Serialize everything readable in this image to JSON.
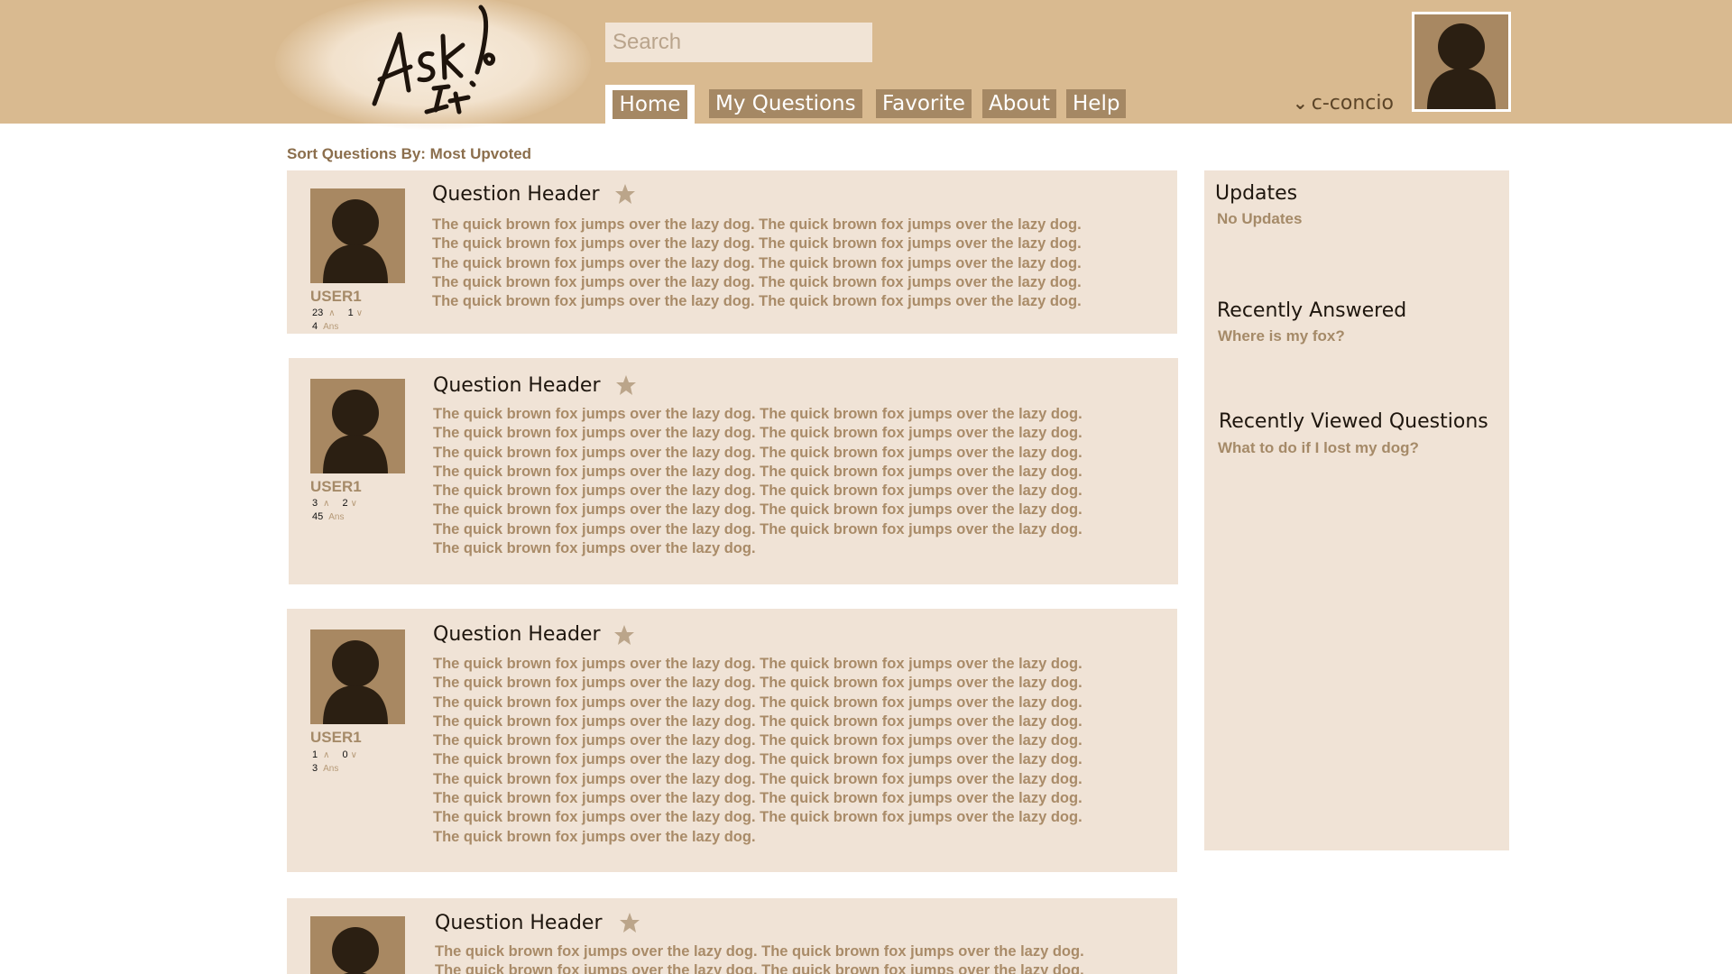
{
  "header": {
    "logo_text": "Ask It!",
    "search_placeholder": "Search",
    "nav": [
      "Home",
      "My Questions",
      "Favorite",
      "About",
      "Help"
    ],
    "username": "c-concio",
    "colors": {
      "header_bg": "#d9ba90",
      "nav_bg": "#a58864",
      "panel_bg": "#f0e3d6"
    }
  },
  "sort": {
    "label": "Sort Questions By: Most Upvoted"
  },
  "questions": [
    {
      "title": "Question Header",
      "user": "USER1",
      "upvotes": "23",
      "downvotes": "1",
      "answers": "4",
      "lines": [
        "The quick brown fox jumps over the lazy dog. The quick brown fox jumps over the lazy dog.",
        "The quick brown fox jumps over the lazy dog. The quick brown fox jumps over the lazy dog.",
        "The quick brown fox jumps over the lazy dog. The quick brown fox jumps over the lazy dog.",
        "The quick brown fox jumps over the lazy dog. The quick brown fox jumps over the lazy dog.",
        "The quick brown fox jumps over the lazy dog. The quick brown fox jumps over the lazy dog."
      ]
    },
    {
      "title": "Question Header",
      "user": "USER1",
      "upvotes": "3",
      "downvotes": "2",
      "answers": "45",
      "lines": [
        "The quick brown fox jumps over the lazy dog. The quick brown fox jumps over the lazy dog.",
        "The quick brown fox jumps over the lazy dog. The quick brown fox jumps over the lazy dog.",
        "The quick brown fox jumps over the lazy dog. The quick brown fox jumps over the lazy dog.",
        "The quick brown fox jumps over the lazy dog. The quick brown fox jumps over the lazy dog.",
        "The quick brown fox jumps over the lazy dog. The quick brown fox jumps over the lazy dog.",
        "The quick brown fox jumps over the lazy dog. The quick brown fox jumps over the lazy dog.",
        "The quick brown fox jumps over the lazy dog. The quick brown fox jumps over the lazy dog.",
        "The quick brown fox jumps over the lazy dog."
      ]
    },
    {
      "title": "Question Header",
      "user": "USER1",
      "upvotes": "1",
      "downvotes": "0",
      "answers": "3",
      "lines": [
        "The quick brown fox jumps over the lazy dog. The quick brown fox jumps over the lazy dog.",
        "The quick brown fox jumps over the lazy dog. The quick brown fox jumps over the lazy dog.",
        "The quick brown fox jumps over the lazy dog. The quick brown fox jumps over the lazy dog.",
        "The quick brown fox jumps over the lazy dog. The quick brown fox jumps over the lazy dog.",
        "The quick brown fox jumps over the lazy dog. The quick brown fox jumps over the lazy dog.",
        "The quick brown fox jumps over the lazy dog. The quick brown fox jumps over the lazy dog.",
        "The quick brown fox jumps over the lazy dog. The quick brown fox jumps over the lazy dog.",
        "The quick brown fox jumps over the lazy dog. The quick brown fox jumps over the lazy dog.",
        "The quick brown fox jumps over the lazy dog. The quick brown fox jumps over the lazy dog.",
        "The quick brown fox jumps over the lazy dog."
      ]
    },
    {
      "title": "Question Header",
      "lines": [
        "The quick brown fox jumps over the lazy dog. The quick brown fox jumps over the lazy dog.",
        "The quick brown fox jumps over the lazy dog. The quick brown fox jumps over the lazy dog."
      ]
    }
  ],
  "sidebar": {
    "updates": {
      "heading": "Updates",
      "text": "No Updates"
    },
    "recently_answered": {
      "heading": "Recently Answered",
      "text": "Where is my fox?"
    },
    "recently_viewed": {
      "heading": "Recently Viewed Questions",
      "text": "What to do if I lost my dog?"
    }
  },
  "icons": {
    "star": "star-icon",
    "avatar": "avatar-silhouette-icon",
    "user_menu": "chevron-down-icon",
    "upvote": "up-chevron-icon",
    "downvote": "down-chevron-icon"
  }
}
